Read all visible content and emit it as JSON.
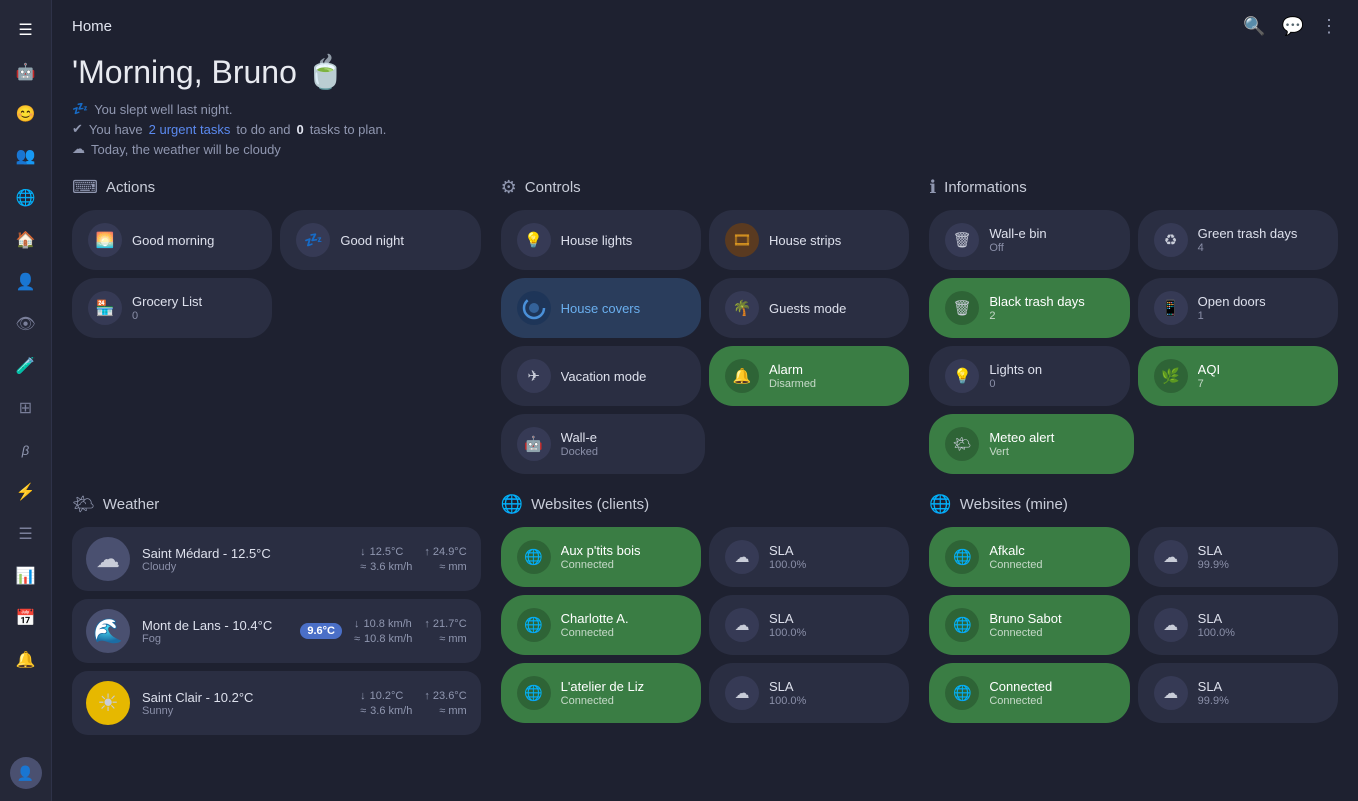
{
  "app": {
    "title": "Home"
  },
  "greeting": {
    "headline": "'Morning, Bruno 🍵",
    "sleep_text": "You slept well last night.",
    "tasks_prefix": "You have ",
    "tasks_link": "2 urgent tasks",
    "tasks_suffix": " to do and ",
    "tasks_count": "0",
    "tasks_end": " tasks to plan.",
    "weather_text": "Today, the weather will be cloudy"
  },
  "sections": {
    "actions": {
      "title": "Actions",
      "icon": "⌨",
      "cards": [
        {
          "icon": "🌅",
          "title": "Good morning",
          "subtitle": ""
        },
        {
          "icon": "💤",
          "title": "Good night",
          "subtitle": ""
        },
        {
          "icon": "🏪",
          "title": "Grocery List",
          "subtitle": "0"
        }
      ]
    },
    "controls": {
      "title": "Controls",
      "icon": "⚙",
      "cards": [
        {
          "icon": "💡",
          "title": "House lights",
          "subtitle": "",
          "green": false
        },
        {
          "icon": "🎞",
          "title": "House strips",
          "subtitle": "",
          "green": false
        },
        {
          "icon": "🪟",
          "title": "House covers",
          "subtitle": "",
          "green": false,
          "active": true
        },
        {
          "icon": "🌴",
          "title": "Guests mode",
          "subtitle": "",
          "green": false
        },
        {
          "icon": "✈",
          "title": "Vacation mode",
          "subtitle": "",
          "green": false
        },
        {
          "icon": "🔔",
          "title": "Alarm",
          "subtitle": "Disarmed",
          "green": true
        },
        {
          "icon": "🤖",
          "title": "Wall-e",
          "subtitle": "Docked",
          "green": false
        }
      ]
    },
    "informations": {
      "title": "Informations",
      "icon": "ℹ",
      "cards": [
        {
          "icon": "🗑",
          "title": "Wall-e bin",
          "subtitle": "Off",
          "green": false
        },
        {
          "icon": "♻",
          "title": "Green trash days",
          "subtitle": "4",
          "green": false
        },
        {
          "icon": "🗑",
          "title": "Black trash days",
          "subtitle": "2",
          "green": true
        },
        {
          "icon": "📱",
          "title": "Open doors",
          "subtitle": "1",
          "green": false
        },
        {
          "icon": "💡",
          "title": "Lights on",
          "subtitle": "0",
          "green": false
        },
        {
          "icon": "🌿",
          "title": "AQI",
          "subtitle": "7",
          "green": true
        },
        {
          "icon": "🌤",
          "title": "Meteo alert",
          "subtitle": "Vert",
          "green": true
        }
      ]
    }
  },
  "weather": {
    "title": "Weather",
    "icon": "🌤",
    "items": [
      {
        "icon": "☁",
        "icon_bg": "#4a5070",
        "city": "Saint Médard  - 12.5°C",
        "condition": "Cloudy",
        "temp_min": "↓ 12.5°C",
        "temp_max": "↑ 24.9°C",
        "wind": "≈ 3.6 km/h",
        "rain": "≈ mm",
        "badge": null
      },
      {
        "icon": "🌊",
        "icon_bg": "#4a5070",
        "city": "Mont de Lans  - 10.4°C",
        "condition": "Fog",
        "temp_min": "↓ 10.8 km/h",
        "temp_max": "↑ 21.7°C",
        "wind": "≈ 10.8 km/h",
        "rain": "≈ mm",
        "badge": "9.6°C"
      },
      {
        "icon": "☀",
        "icon_bg": "#e6b800",
        "city": "Saint Clair  - 10.2°C",
        "condition": "Sunny",
        "temp_min": "↓ 10.2°C",
        "temp_max": "↑ 23.6°C",
        "wind": "≈ 3.6 km/h",
        "rain": "≈ mm",
        "badge": null
      }
    ]
  },
  "websites_clients": {
    "title": "Websites (clients)",
    "icon": "🌐",
    "items": [
      {
        "name": "Aux p'tits bois",
        "status": "Connected",
        "green": true
      },
      {
        "name": "SLA",
        "status": "100.0%",
        "green": false
      },
      {
        "name": "Charlotte A.",
        "status": "Connected",
        "green": true
      },
      {
        "name": "SLA",
        "status": "100.0%",
        "green": false
      },
      {
        "name": "L'atelier de Liz",
        "status": "Connected",
        "green": true
      },
      {
        "name": "SLA",
        "status": "100.0%",
        "green": false
      }
    ]
  },
  "websites_mine": {
    "title": "Websites (mine)",
    "icon": "🌐",
    "items": [
      {
        "name": "Afkalc",
        "status": "Connected",
        "green": true
      },
      {
        "name": "SLA",
        "status": "99.9%",
        "green": false
      },
      {
        "name": "Bruno Sabot",
        "status": "Connected",
        "green": true
      },
      {
        "name": "SLA",
        "status": "100.0%",
        "green": false
      },
      {
        "name": "Connected",
        "status": "Connected",
        "green": true
      },
      {
        "name": "SLA",
        "status": "99.9%",
        "green": false
      }
    ]
  },
  "sidebar": {
    "icons": [
      "☰",
      "🤖",
      "😊",
      "👥",
      "🌐",
      "🏠",
      "👤",
      "👁",
      "🧪",
      "📊",
      "📅",
      "🔔"
    ]
  },
  "topbar": {
    "icons": [
      "🔍",
      "💬",
      "⋮"
    ]
  }
}
